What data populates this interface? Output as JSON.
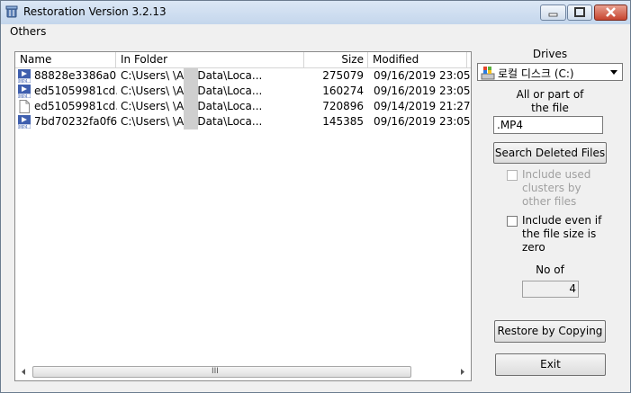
{
  "window": {
    "title": "Restoration Version 3.2.13"
  },
  "menu": {
    "items": [
      {
        "label": "Others"
      }
    ]
  },
  "list": {
    "columns": [
      "Name",
      "In Folder",
      "Size",
      "Modified"
    ],
    "rows": [
      {
        "name": "88828e3386a0...",
        "folder": "C:\\Users\\ \\AppData\\Loca...",
        "size": "275079",
        "modified": "09/16/2019 23:05",
        "icon": "mp4-file-icon"
      },
      {
        "name": "ed51059981cd...",
        "folder": "C:\\Users\\ \\AppData\\Loca...",
        "size": "160274",
        "modified": "09/16/2019 23:05",
        "icon": "mp4-file-icon"
      },
      {
        "name": "ed51059981cd...",
        "folder": "C:\\Users\\ \\AppData\\Loca...",
        "size": "720896",
        "modified": "09/14/2019 21:27",
        "icon": "blank-file-icon"
      },
      {
        "name": "7bd70232fa0f6...",
        "folder": "C:\\Users\\ \\AppData\\Loca...",
        "size": "145385",
        "modified": "09/16/2019 23:05",
        "icon": "mp4-file-icon"
      }
    ],
    "scroll_grip": "III"
  },
  "panel": {
    "drives_label": "Drives",
    "drive_selected": "로컬 디스크 (C:)",
    "file_label_line1": "All or part of",
    "file_label_line2": "the file",
    "file_value": ".MP4",
    "search_button": "Search Deleted Files",
    "include_used": {
      "line1": "Include used",
      "line2": "clusters by",
      "line3": "other files",
      "checked": false,
      "enabled": false
    },
    "include_zero": {
      "line1": "Include even if",
      "line2": "the file size is",
      "line3": "zero",
      "checked": false,
      "enabled": true
    },
    "no_of_label": "No of",
    "no_of_value": "4",
    "restore_button": "Restore by Copying",
    "exit_button": "Exit"
  },
  "colors": {
    "titlebar": "#c4d6ec",
    "close_button": "#c6442f",
    "disabled_text": "#a0a0a0"
  }
}
